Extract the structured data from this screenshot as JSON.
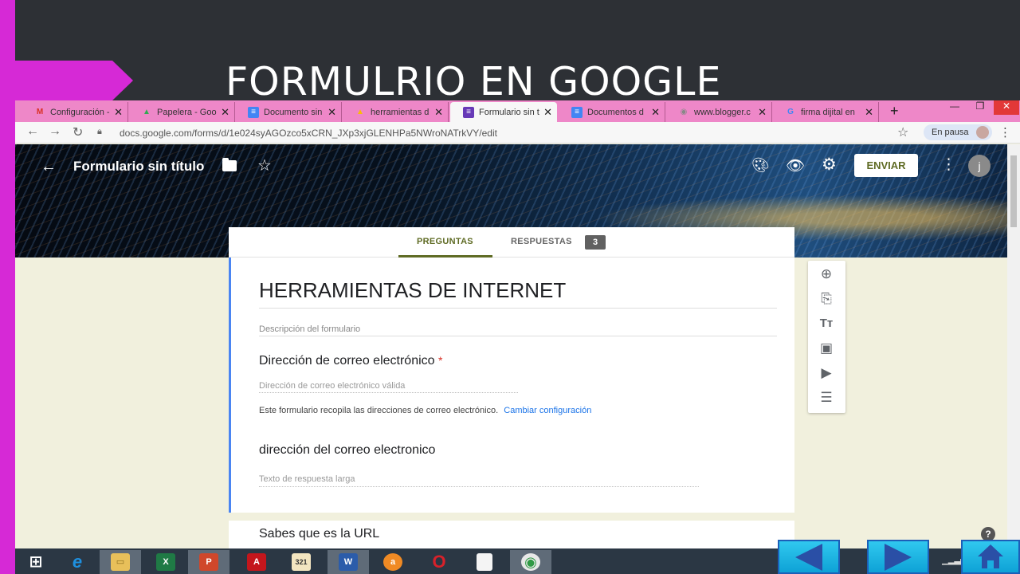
{
  "slide": {
    "title": "FORMULRIO EN GOOGLE"
  },
  "browser": {
    "tabs": [
      {
        "label": "Configuración -",
        "icon": "M",
        "icon_color": "#d93025"
      },
      {
        "label": "Papelera - Goo",
        "icon": "▲",
        "icon_color": "#34a853"
      },
      {
        "label": "Documento sin",
        "icon": "≡",
        "icon_color": "#4285f4"
      },
      {
        "label": "herramientas d",
        "icon": "▲",
        "icon_color": "#fbbc05"
      },
      {
        "label": "Formulario sin t",
        "icon": "≡",
        "icon_color": "#673ab7"
      },
      {
        "label": "Documentos d",
        "icon": "≡",
        "icon_color": "#4285f4"
      },
      {
        "label": "www.blogger.c",
        "icon": "◉",
        "icon_color": "#888888"
      },
      {
        "label": "firma dijital en",
        "icon": "G",
        "icon_color": "#4285f4"
      }
    ],
    "url": "docs.google.com/forms/d/1e024syAGOzco5xCRN_JXp3xjGLENHPa5NWroNATrkVY/edit",
    "pause_label": "En pausa"
  },
  "form": {
    "top_title": "Formulario sin título",
    "send_label": "ENVIAR",
    "avatar_letter": "j",
    "tabs": {
      "questions": "PREGUNTAS",
      "responses": "RESPUESTAS",
      "response_count": "3"
    },
    "heading": "HERRAMIENTAS DE INTERNET",
    "description_placeholder": "Descripción del formulario",
    "questions": [
      {
        "title": "Dirección de correo electrónico",
        "required_mark": "*",
        "placeholder": "Dirección de correo electrónico válida"
      },
      {
        "title": "dirección del correo electronico",
        "placeholder": "Texto de respuesta larga"
      },
      {
        "title": "Sabes que es la URL"
      }
    ],
    "collect_note": "Este formulario recopila las direcciones de correo electrónico.",
    "collect_link": "Cambiar configuración"
  },
  "taskbar": {
    "apps": [
      {
        "name": "windows",
        "label": "⊞",
        "color": "#ffffff"
      },
      {
        "name": "ie",
        "label": "e",
        "color": "#1e90e0"
      },
      {
        "name": "explorer",
        "label": "▭",
        "color": "#e8c05a"
      },
      {
        "name": "excel",
        "label": "X",
        "color": "#1f7a45"
      },
      {
        "name": "powerpoint",
        "label": "P",
        "color": "#d0472b"
      },
      {
        "name": "acrobat",
        "label": "A",
        "color": "#c4161c"
      },
      {
        "name": "media",
        "label": "321",
        "color": "#8b5a2b"
      },
      {
        "name": "word",
        "label": "W",
        "color": "#2b5caa"
      },
      {
        "name": "avast",
        "label": "a",
        "color": "#f08a24"
      },
      {
        "name": "opera",
        "label": "O",
        "color": "#d8212a"
      },
      {
        "name": "file",
        "label": "",
        "color": "#f4f4f4"
      },
      {
        "name": "chrome",
        "label": "◉",
        "color": "#2f9a44"
      }
    ]
  },
  "colors": {
    "accent_pink": "#d629d6",
    "forms_olive": "#5f6b24",
    "nav_cyan": "#1aaee0"
  }
}
